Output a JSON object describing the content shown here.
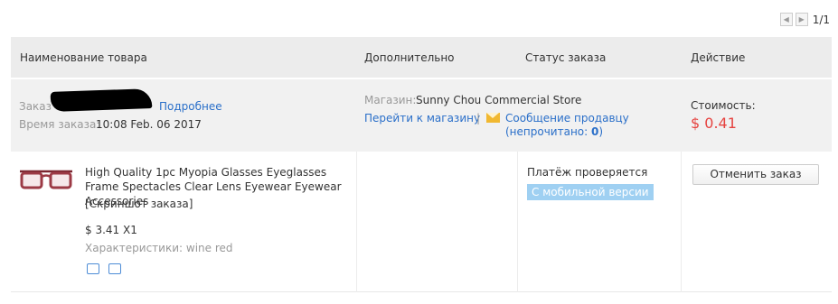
{
  "pager": {
    "text": "1/1"
  },
  "header": {
    "col_name": "Наименование товара",
    "col_extra": "Дополнительно",
    "col_status": "Статус заказа",
    "col_action": "Действие"
  },
  "order": {
    "order_label": "Заказ",
    "details_link": "Подробнее",
    "time_label": "Время заказа:",
    "time_value": "10:08 Feb. 06 2017",
    "store_label": "Магазин:",
    "store_name": "Sunny Chou Commercial Store",
    "goto_store": "Перейти к магазину",
    "separator": "|",
    "message_seller": "Сообщение продавцу",
    "unread_prefix": "(непрочитано: ",
    "unread_count": "0",
    "unread_suffix": ")",
    "cost_label": "Стоимость:",
    "cost_value": "$ 0.41"
  },
  "item": {
    "title": "High Quality 1pc Myopia Glasses Eyeglasses Frame Spectacles Clear Lens Eyewear Eyewear Accessories",
    "screenshot_link": "[Скриншот заказа]",
    "price": "$ 3.41 X1",
    "attributes": "Характеристики: wine red",
    "status": "Платёж проверяется",
    "mobile_badge": "С мобильной версии",
    "cancel_button": "Отменить заказ",
    "icons": [
      "truck-icon",
      "card-icon"
    ]
  },
  "colors": {
    "header_bg": "#ececec",
    "info_bg": "#f1f1f1",
    "link": "#2a6fc9",
    "price_red": "#e64340",
    "badge_bg": "#9fd0f2"
  }
}
